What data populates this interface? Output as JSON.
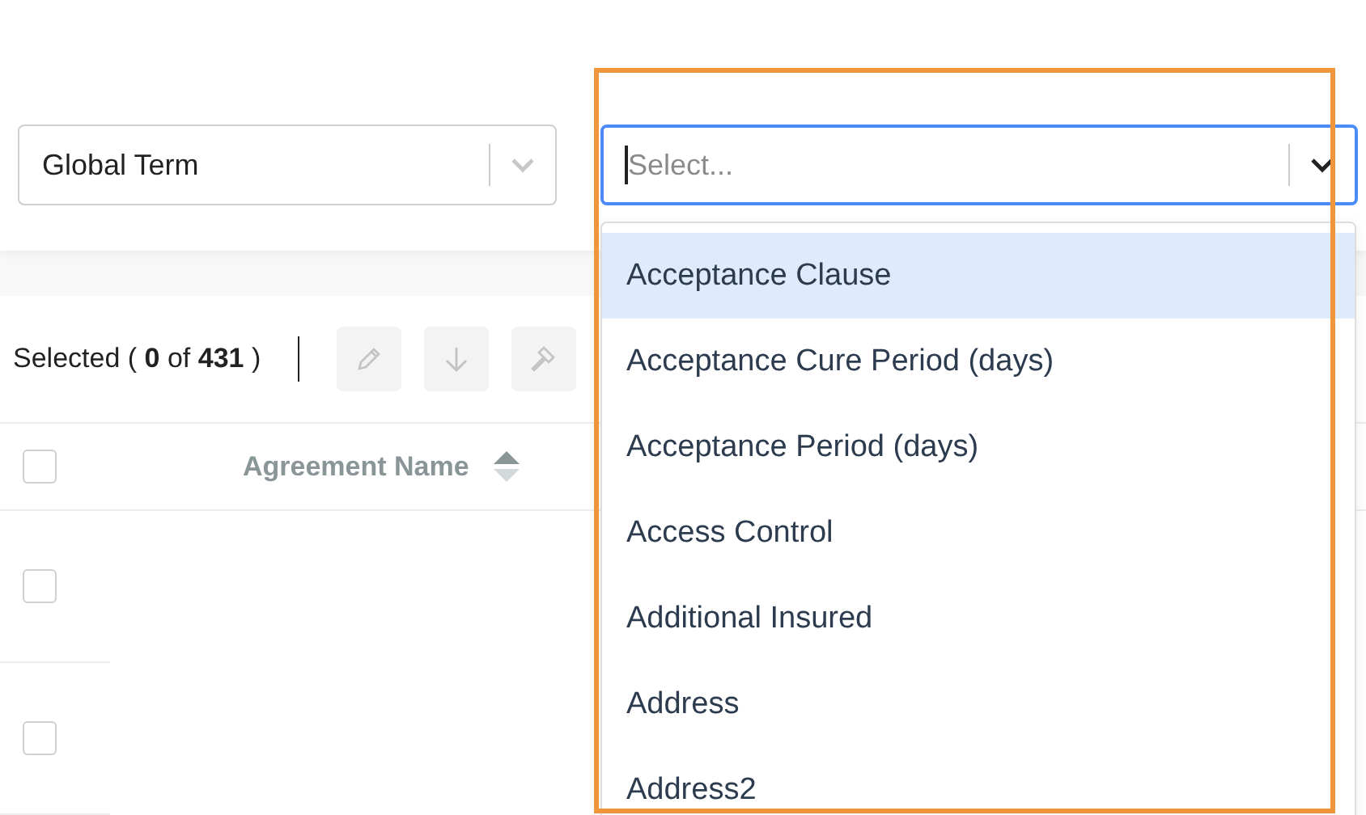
{
  "filters": [
    {
      "value": "Global Term",
      "open": false
    },
    {
      "placeholder": "Select...",
      "open": true
    }
  ],
  "dropdown": {
    "options": [
      {
        "label": "Acceptance Clause",
        "selected": true
      },
      {
        "label": "Acceptance Cure Period (days)",
        "selected": false
      },
      {
        "label": "Acceptance Period (days)",
        "selected": false
      },
      {
        "label": "Access Control",
        "selected": false
      },
      {
        "label": "Additional Insured",
        "selected": false
      },
      {
        "label": "Address",
        "selected": false
      },
      {
        "label": "Address2",
        "selected": false
      }
    ]
  },
  "toolbar": {
    "selection_summary": "Selected ( **0** of **431** )",
    "actions": [
      {
        "kind": "edit",
        "disabled": true
      },
      {
        "kind": "download",
        "disabled": true
      },
      {
        "kind": "gavel",
        "disabled": true
      }
    ]
  },
  "table": {
    "header_checked": false,
    "columns": [
      {
        "label": "Agreement Name"
      }
    ],
    "rows": [
      {
        "checked": false
      },
      {
        "checked": false
      }
    ]
  }
}
